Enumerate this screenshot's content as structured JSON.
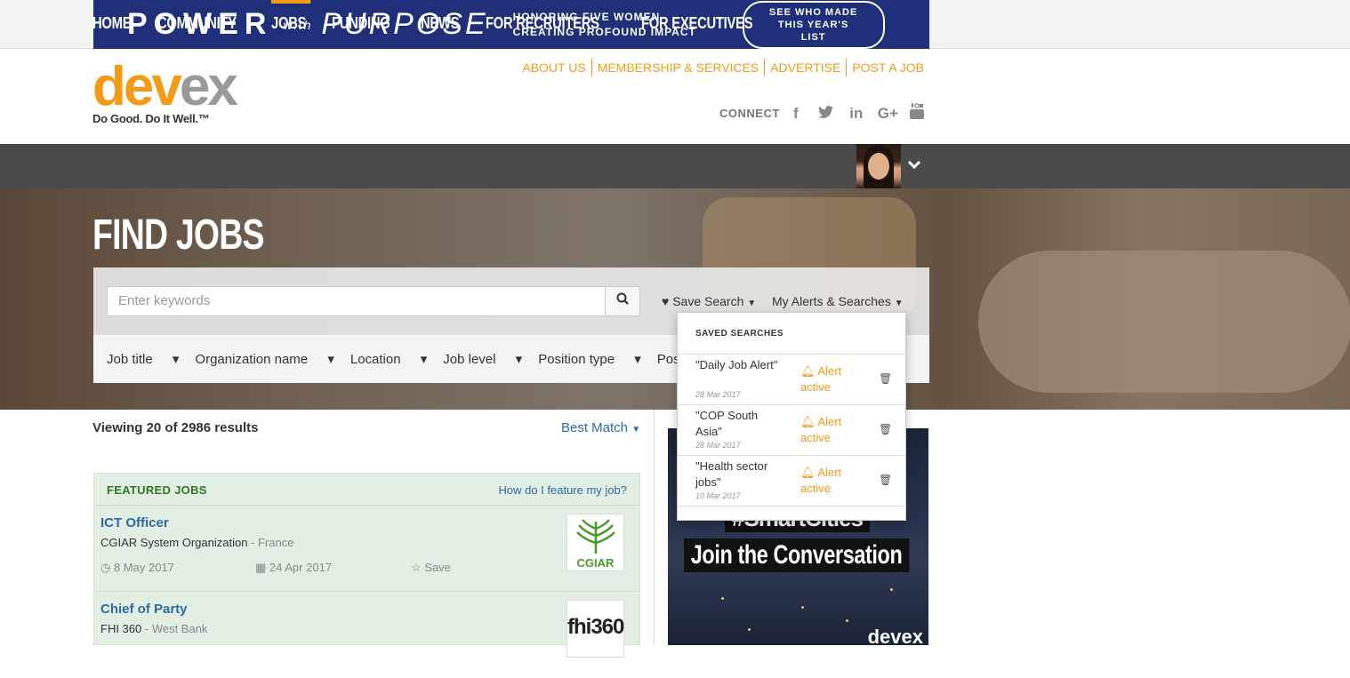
{
  "banner": {
    "power": "POWER",
    "with": "with",
    "purpose": "PURPOSE",
    "honoring": "HONORING FIVE WOMEN CREATING PROFOUND IMPACT",
    "cta": "SEE WHO MADE THIS YEAR'S LIST"
  },
  "logo": {
    "dev": "dev",
    "ex": "ex",
    "tagline": "Do Good. Do It Well.™"
  },
  "toplinks": [
    "ABOUT US",
    "MEMBERSHIP & SERVICES",
    "ADVERTISE",
    "POST A JOB"
  ],
  "connect": {
    "label": "CONNECT",
    "icons": [
      "facebook-icon",
      "twitter-icon",
      "linkedin-icon",
      "google-plus-icon",
      "youtube-icon"
    ]
  },
  "nav": [
    "HOME",
    "COMMUNITY",
    "JOBS",
    "FUNDING",
    "NEWS",
    "FOR RECRUITERS",
    "FOR EXECUTIVES"
  ],
  "nav_active": "JOBS",
  "page_title": "FIND JOBS",
  "search": {
    "placeholder": "Enter keywords",
    "save_search": "Save Search",
    "my_alerts": "My Alerts & Searches"
  },
  "filters": [
    "Job title",
    "Organization name",
    "Location",
    "Job level",
    "Position type",
    "Posted date"
  ],
  "saved_searches": {
    "header": "SAVED SEARCHES",
    "items": [
      {
        "name": "\"Daily Job Alert\"",
        "date": "28 Mar 2017",
        "alert": "Alert active"
      },
      {
        "name": "\"COP South Asia\"",
        "date": "28 Mar 2017",
        "alert": "Alert active"
      },
      {
        "name": "\"Health sector jobs\"",
        "date": "10 Mar 2017",
        "alert": "Alert active"
      }
    ]
  },
  "results": {
    "text": "Viewing 20 of 2986 results",
    "sort": "Best Match"
  },
  "featured": {
    "title": "FEATURED JOBS",
    "how": "How do I feature my job?",
    "jobs": [
      {
        "title": "ICT Officer",
        "org": "CGIAR System Organization",
        "location": "France",
        "deadline": "8 May 2017",
        "posted": "24 Apr 2017",
        "save": "Save",
        "logo": "CGIAR"
      },
      {
        "title": "Chief of Party",
        "org": "FHI 360",
        "location": "West Bank",
        "logo": "fhi360"
      }
    ]
  },
  "ad": {
    "hashtag": "#SmartCities",
    "join": "Join the Conversation",
    "brand": "devex"
  },
  "colors": {
    "accent": "#f39a17",
    "link": "#2b6aa8",
    "nav_bg": "#4a4a4a",
    "featured_bg": "#e3efe3",
    "banner_bg": "#1f2f7a"
  }
}
